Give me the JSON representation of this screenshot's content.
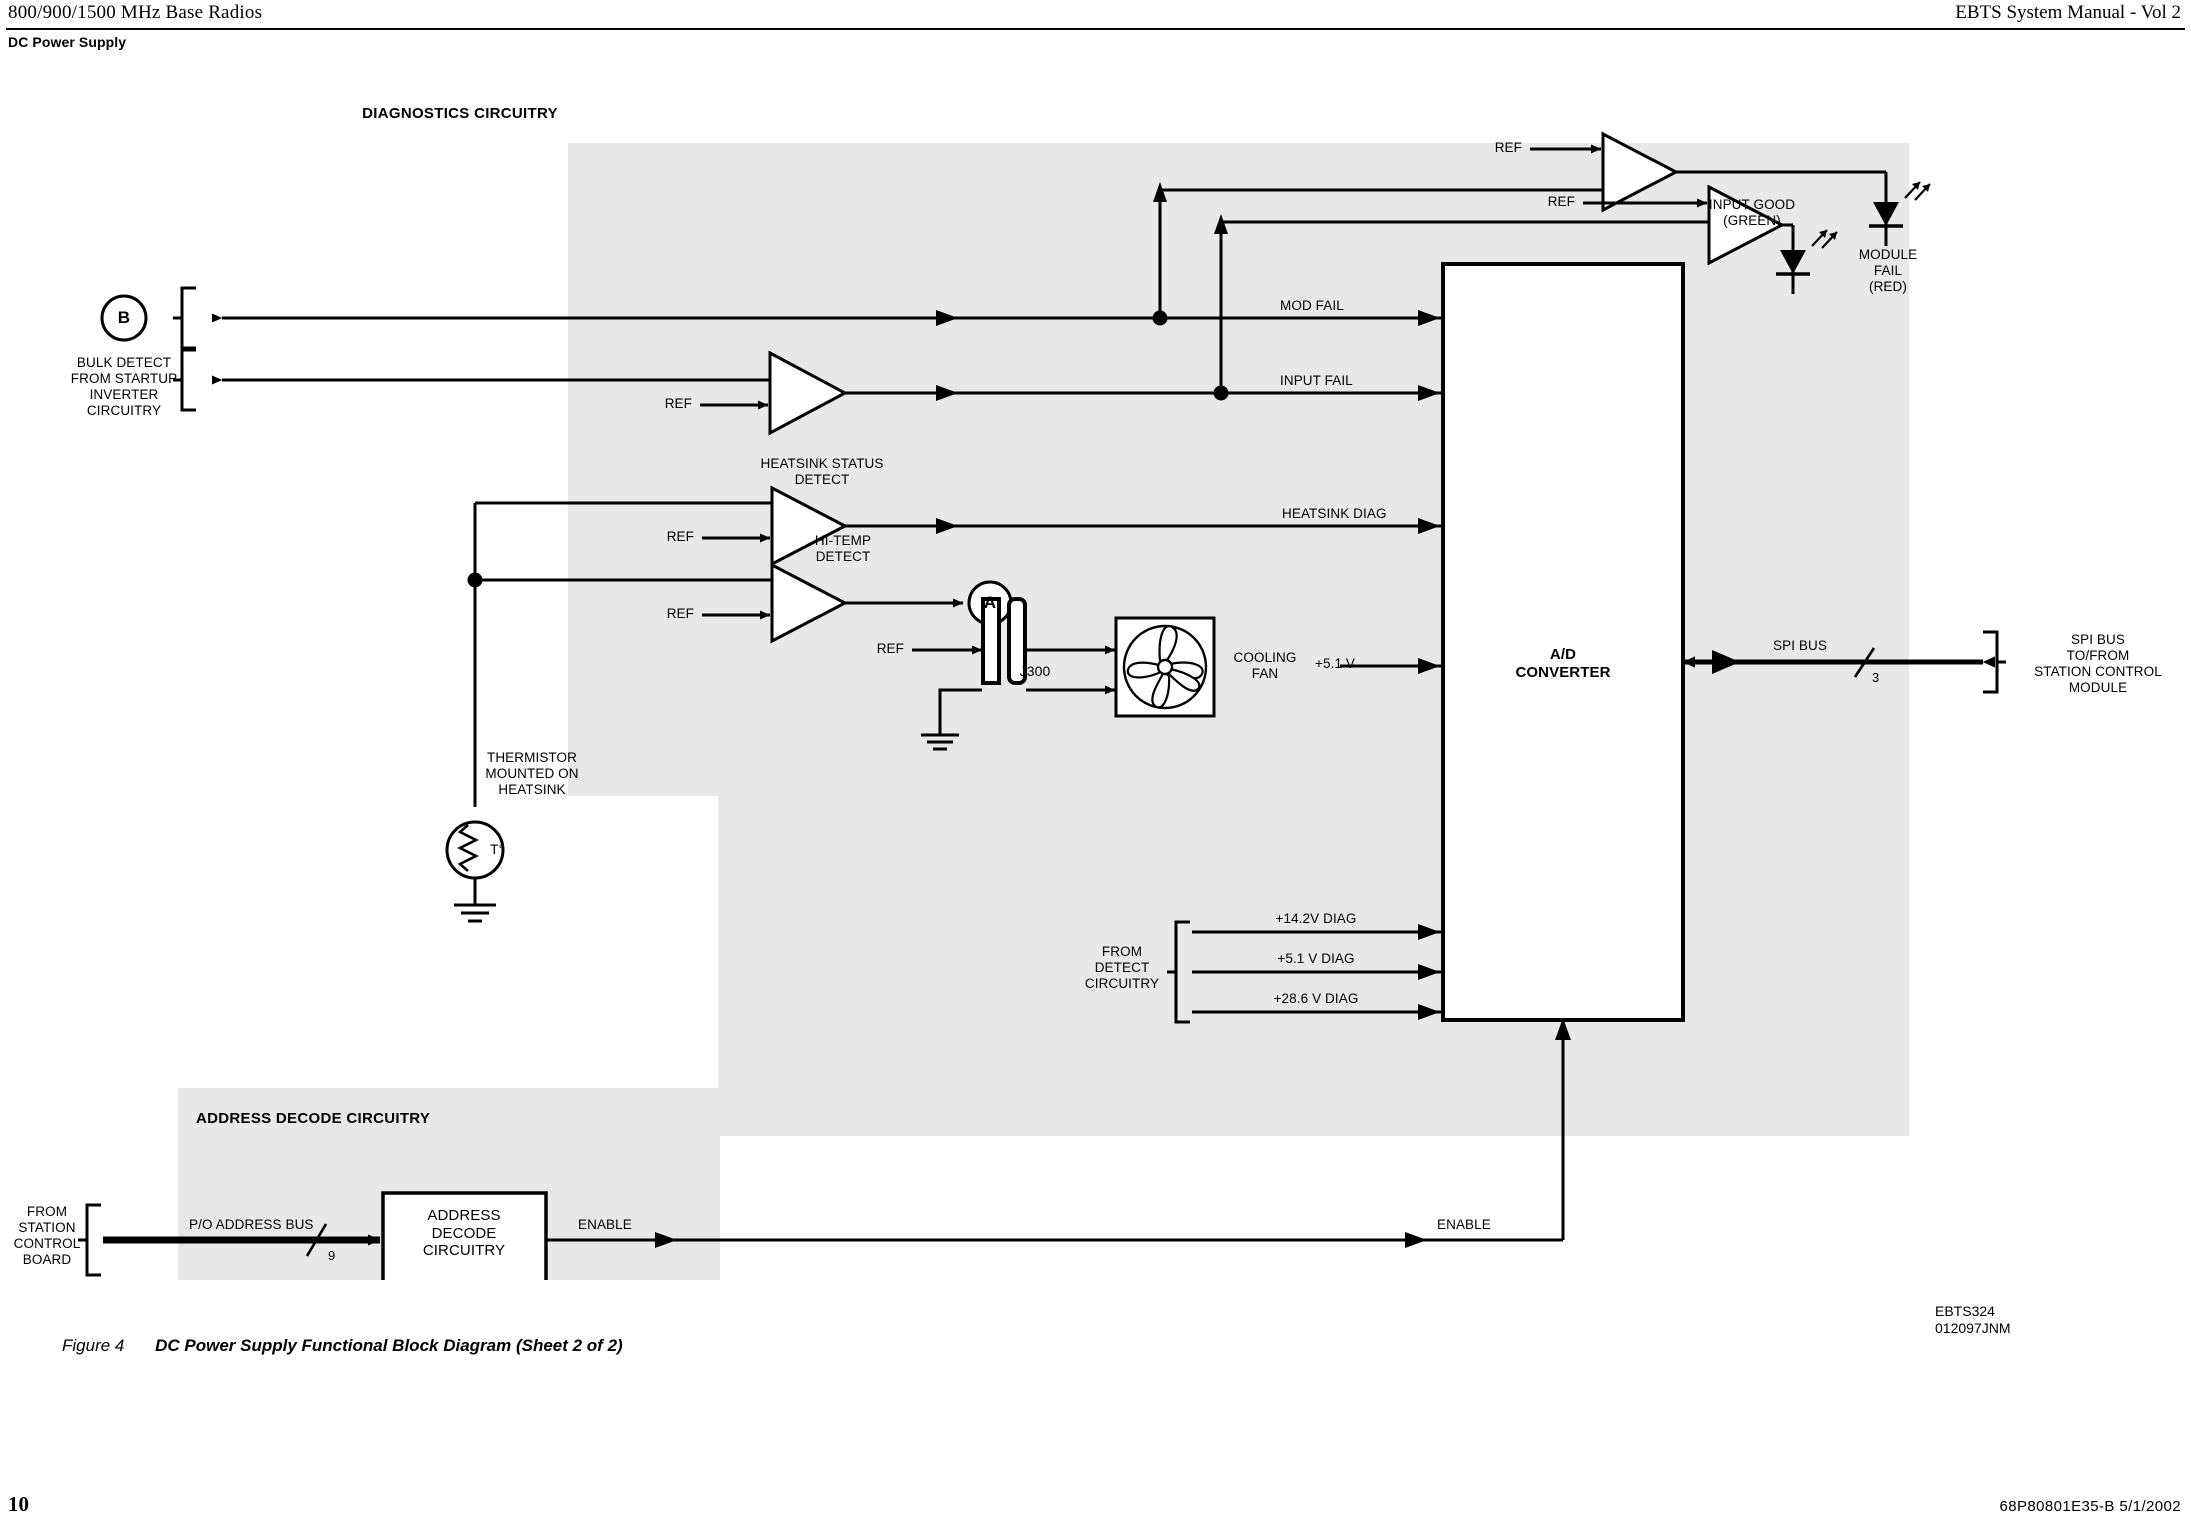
{
  "header": {
    "left": "800/900/1500 MHz Base Radios",
    "right": "EBTS System Manual - Vol 2",
    "section": "DC Power Supply"
  },
  "footer": {
    "page_number": "10",
    "doc_id": "68P80801E35-B   5/1/2002"
  },
  "figure": {
    "number": "Figure 4",
    "title": "DC Power Supply Functional Block Diagram (Sheet 2 of 2)",
    "drawing_id_line1": "EBTS324",
    "drawing_id_line2": "012097JNM"
  },
  "diagram": {
    "group_titles": {
      "diagnostics": "DIAGNOSTICS CIRCUITRY",
      "address_decode": "ADDRESS DECODE CIRCUITRY"
    },
    "connectors": {
      "b_tag": "B",
      "a_tag": "A"
    },
    "sources": {
      "bulk_detect": "BULK DETECT\nFROM STARTUP\nINVERTER\nCIRCUITRY",
      "bulk_detect_lines": [
        "BULK DETECT",
        "FROM STARTUP",
        "INVERTER",
        "CIRCUITRY"
      ],
      "from_detect_lines": [
        "FROM",
        "DETECT",
        "CIRCUITRY"
      ],
      "from_station_control_board_lines": [
        "FROM",
        "STATION",
        "CONTROL",
        "BOARD"
      ],
      "spi_bus_dest_lines": [
        "SPI BUS",
        "TO/FROM",
        "STATION CONTROL",
        "MODULE"
      ]
    },
    "ref_label": "REF",
    "comparators": [
      {
        "name": "input-fail-comparator",
        "label": ""
      },
      {
        "name": "heatsink-status-detect",
        "label_lines": [
          "HEATSINK STATUS",
          "DETECT"
        ]
      },
      {
        "name": "hi-temp-detect",
        "label_lines": [
          "HI-TEMP",
          "DETECT"
        ]
      },
      {
        "name": "module-fail-comparator",
        "label": ""
      },
      {
        "name": "input-good-comparator",
        "label": ""
      }
    ],
    "signals": {
      "mod_fail": "MOD FAIL",
      "input_fail": "INPUT FAIL",
      "heatsink_diag": "HEATSINK DIAG",
      "plus_5_1_v": "+5.1 V",
      "diag_14_2": "+14.2V DIAG",
      "diag_5_1": "+5.1 V DIAG",
      "diag_28_6": "+28.6 V DIAG",
      "spi_bus": "SPI BUS",
      "spi_bus_width": "3",
      "po_address_bus": "P/O ADDRESS BUS",
      "address_bus_width": "9",
      "enable_out": "ENABLE",
      "enable_in": "ENABLE"
    },
    "leds": [
      {
        "name": "module-fail-led",
        "label_lines": [
          "MODULE",
          "FAIL",
          "(RED)"
        ],
        "color": "RED"
      },
      {
        "name": "input-good-led",
        "label_lines": [
          "INPUT GOOD",
          "(GREEN)"
        ],
        "color": "GREEN"
      }
    ],
    "blocks": {
      "ad_converter_lines": [
        "A/D",
        "CONVERTER"
      ],
      "address_decode_lines": [
        "ADDRESS",
        "DECODE",
        "CIRCUITRY"
      ]
    },
    "components": {
      "thermistor_symbol": "T°",
      "thermistor_lines": [
        "THERMISTOR",
        "MOUNTED ON",
        "HEATSINK"
      ],
      "connector_j300": "J300",
      "cooling_fan_lines": [
        "COOLING",
        "FAN"
      ]
    },
    "colors": {
      "shade": "#e8e8e8",
      "line": "#000000",
      "paper": "#ffffff"
    }
  }
}
